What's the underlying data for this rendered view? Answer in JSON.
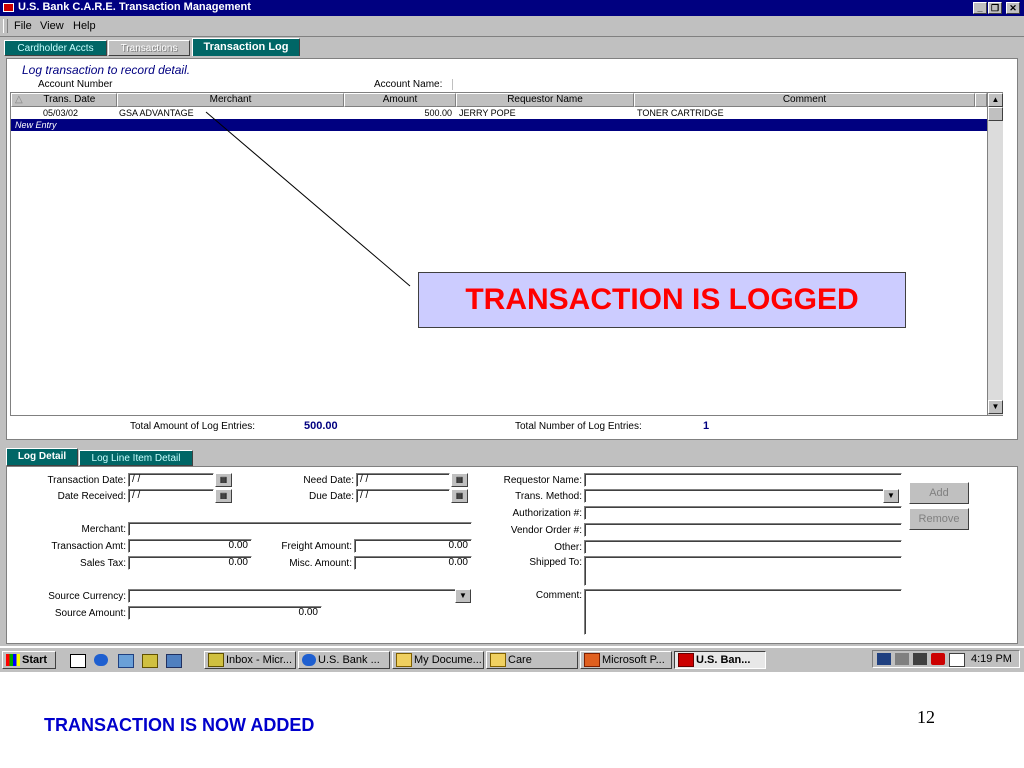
{
  "window": {
    "title": "U.S. Bank C.A.R.E. Transaction Management",
    "controls": [
      "_",
      "❐",
      "✕"
    ]
  },
  "menu": [
    "File",
    "View",
    "Help"
  ],
  "tabs": [
    {
      "label": "Cardholder Accts",
      "state": "normal"
    },
    {
      "label": "Transactions",
      "state": "disabled"
    },
    {
      "label": "Transaction Log",
      "state": "active"
    }
  ],
  "log": {
    "heading": "Log transaction to record detail.",
    "account_number_label": "Account Number",
    "account_name_label": "Account Name:",
    "columns": [
      "Trans. Date",
      "Merchant",
      "Amount",
      "Requestor Name",
      "Comment"
    ],
    "rows": [
      {
        "date": "05/03/02",
        "merchant": "GSA ADVANTAGE",
        "amount": "500.00",
        "requestor": "JERRY POPE",
        "comment": "TONER CARTRIDGE"
      }
    ],
    "new_entry": "New Entry",
    "total_amount_label": "Total Amount of Log Entries:",
    "total_amount": "500.00",
    "total_count_label": "Total Number of Log Entries:",
    "total_count": "1"
  },
  "callout": "TRANSACTION IS LOGGED",
  "detail_tabs": [
    "Log Detail",
    "Log Line Item Detail"
  ],
  "detail": {
    "transaction_date_label": "Transaction Date:",
    "transaction_date": " / /",
    "date_received_label": "Date Received:",
    "date_received": " / /",
    "need_date_label": "Need Date:",
    "need_date": " / /",
    "due_date_label": "Due Date:",
    "due_date": " / /",
    "merchant_label": "Merchant:",
    "transaction_amt_label": "Transaction Amt:",
    "transaction_amt": "0.00",
    "sales_tax_label": "Sales Tax:",
    "sales_tax": "0.00",
    "freight_amount_label": "Freight Amount:",
    "freight_amount": "0.00",
    "misc_amount_label": "Misc. Amount:",
    "misc_amount": "0.00",
    "source_currency_label": "Source Currency:",
    "source_amount_label": "Source Amount:",
    "source_amount": "0.00",
    "requestor_name_label": "Requestor Name:",
    "trans_method_label": "Trans. Method:",
    "authorization_label": "Authorization #:",
    "vendor_order_label": "Vendor Order #:",
    "other_label": "Other:",
    "shipped_to_label": "Shipped To:",
    "comment_label": "Comment:",
    "add_button": "Add",
    "remove_button": "Remove"
  },
  "taskbar": {
    "start": "Start",
    "tasks": [
      "Inbox - Micr...",
      "U.S. Bank ...",
      "My Docume...",
      "Care",
      "Microsoft P...",
      "U.S. Ban..."
    ],
    "clock": "4:19 PM"
  },
  "slide": {
    "caption": "TRANSACTION IS NOW ADDED",
    "page_number": "12"
  },
  "colors": {
    "title_bar": "#000080",
    "selection": "#000080",
    "callout_bg": "#ccccff",
    "callout_text": "#ff0000",
    "caption": "#0000cc"
  }
}
